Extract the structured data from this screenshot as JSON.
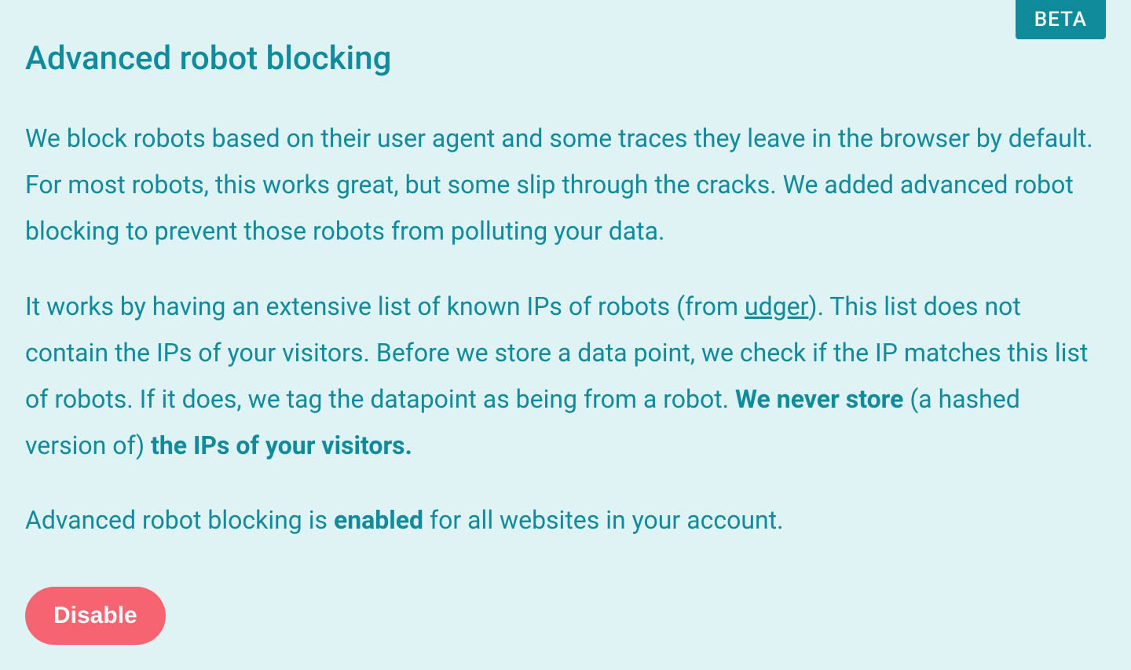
{
  "badge": "BETA",
  "title": "Advanced robot blocking",
  "paragraph1": "We block robots based on their user agent and some traces they leave in the browser by default. For most robots, this works great, but some slip through the cracks. We added advanced robot blocking to prevent those robots from polluting your data.",
  "paragraph2": {
    "part1": "It works by having an extensive list of known IPs of robots (from ",
    "link": "udger",
    "part2": "). This list does not contain the IPs of your visitors. Before we store a data point, we check if the IP matches this list of robots. If it does, we tag the datapoint as being from a robot. ",
    "bold1": "We never store",
    "part3": " (a hashed version of) ",
    "bold2": "the IPs of your visitors."
  },
  "paragraph3": {
    "part1": "Advanced robot blocking is ",
    "bold": "enabled",
    "part2": " for all websites in your account."
  },
  "button": "Disable"
}
